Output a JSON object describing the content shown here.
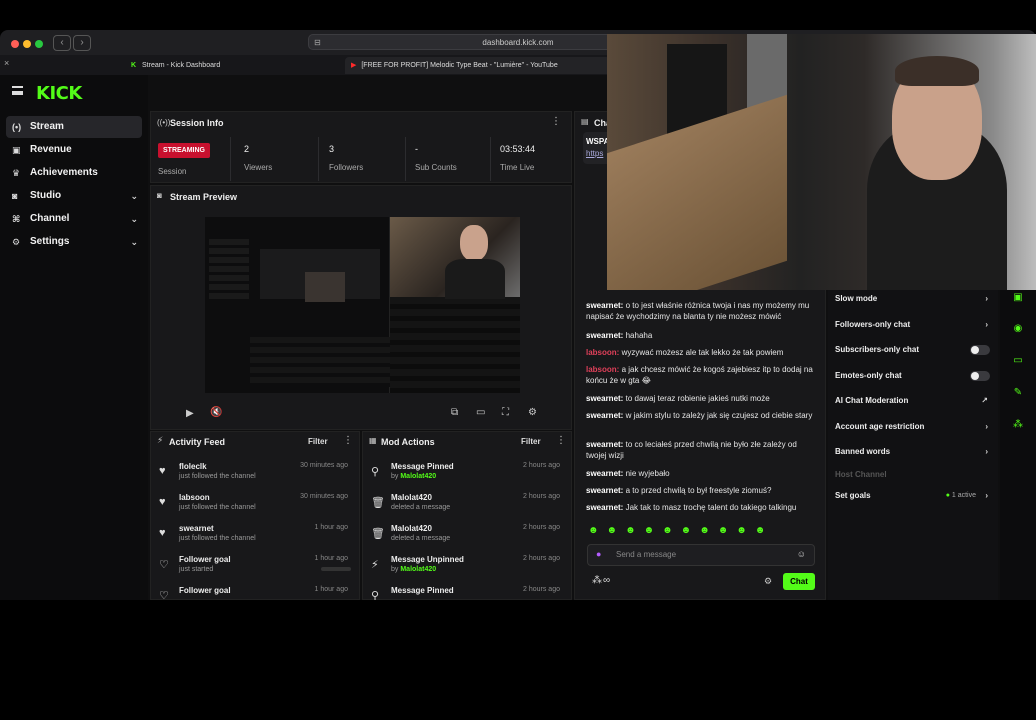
{
  "browser": {
    "url": "dashboard.kick.com",
    "tabs": [
      {
        "label": "Stream - Kick Dashboard"
      },
      {
        "label": "[FREE FOR PROFIT] Melodic Type Beat - \"Lumière\" - YouTube"
      }
    ]
  },
  "colors": {
    "brand": "#53fc18",
    "live": "#c8102e",
    "bg": "#0f0f10",
    "panel": "#18181a"
  },
  "sidebar": {
    "logo": "KICK",
    "items": [
      {
        "label": "Stream",
        "icon": "broadcast-icon",
        "active": true
      },
      {
        "label": "Revenue",
        "icon": "wallet-icon"
      },
      {
        "label": "Achievements",
        "icon": "trophy-icon"
      },
      {
        "label": "Studio",
        "icon": "video-icon",
        "expandable": true
      },
      {
        "label": "Channel",
        "icon": "channel-icon",
        "expandable": true
      },
      {
        "label": "Settings",
        "icon": "gear-icon",
        "expandable": true
      }
    ]
  },
  "session": {
    "title": "Session Info",
    "status": "STREAMING",
    "session_label": "Session",
    "stats": [
      {
        "value": "2",
        "label": "Viewers"
      },
      {
        "value": "3",
        "label": "Followers"
      },
      {
        "value": "-",
        "label": "Sub Counts"
      },
      {
        "value": "03:53:44",
        "label": "Time Live"
      }
    ]
  },
  "preview": {
    "title": "Stream Preview"
  },
  "activity": {
    "title": "Activity Feed",
    "filter": "Filter",
    "items": [
      {
        "name": "floleclk",
        "sub": "just followed the channel",
        "time": "30 minutes ago"
      },
      {
        "name": "labsoon",
        "sub": "just followed the channel",
        "time": "30 minutes ago"
      },
      {
        "name": "swearnet",
        "sub": "just followed the channel",
        "time": "1 hour ago"
      },
      {
        "name": "Follower goal",
        "sub": "just started",
        "time": "1 hour ago"
      },
      {
        "name": "Follower goal",
        "sub": "",
        "time": "1 hour ago"
      }
    ]
  },
  "mod": {
    "title": "Mod Actions",
    "filter": "Filter",
    "items": [
      {
        "name": "Message Pinned",
        "prefix": "by ",
        "who": "Malolat420",
        "sub": "",
        "time": "2 hours ago"
      },
      {
        "name": "Malolat420",
        "prefix": "",
        "who": "",
        "sub": "deleted a message",
        "time": "2 hours ago"
      },
      {
        "name": "Malolat420",
        "prefix": "",
        "who": "",
        "sub": "deleted a message",
        "time": "2 hours ago"
      },
      {
        "name": "Message Unpinned",
        "prefix": "by ",
        "who": "Malolat420",
        "sub": "",
        "time": "2 hours ago"
      },
      {
        "name": "Message Pinned",
        "prefix": "",
        "who": "",
        "sub": "",
        "time": "2 hours ago"
      }
    ]
  },
  "chat": {
    "title": "Cha",
    "pinned_line1": "WSPA",
    "pinned_line2": "https",
    "messages": [
      {
        "user": "swearnet:",
        "text": "o to jest właśnie różnica twoja i nas my możemy mu napisać że wychodzimy na blanta ty nie możesz mówić",
        "red": false
      },
      {
        "user": "swearnet:",
        "text": "hahaha",
        "red": false
      },
      {
        "user": "labsoon:",
        "text": "wyzywać możesz ale tak lekko że tak powiem",
        "red": true
      },
      {
        "user": "labsoon:",
        "text": "a jak chcesz mówić że kogoś zajebiesz itp to dodaj na końcu że w gta 😂",
        "red": true
      },
      {
        "user": "swearnet:",
        "text": "to dawaj teraz robienie jakieś nutki może",
        "red": false
      },
      {
        "user": "swearnet:",
        "text": "w jakim stylu to zależy jak się czujesz od ciebie stary",
        "red": false
      },
      {
        "user": "swearnet:",
        "text": "to co leciałeś przed chwilą nie było złe zależy od twojej wizji",
        "red": false
      },
      {
        "user": "swearnet:",
        "text": "nie wyjebało",
        "red": false
      },
      {
        "user": "swearnet:",
        "text": "a to przed chwilą to był freestyle ziomuś?",
        "red": false
      },
      {
        "user": "swearnet:",
        "text": "Jak tak to masz trochę talent do takiego talkingu",
        "red": false
      }
    ],
    "placeholder": "Send a message",
    "send": "Chat",
    "infinity": "∞"
  },
  "chat_settings": {
    "items": [
      {
        "label": "Slow mode",
        "kind": "arrow"
      },
      {
        "label": "Followers-only chat",
        "kind": "arrow"
      },
      {
        "label": "Subscribers-only chat",
        "kind": "toggle"
      },
      {
        "label": "Emotes-only chat",
        "kind": "toggle"
      },
      {
        "label": "AI Chat Moderation",
        "kind": "ext"
      },
      {
        "label": "Account age restriction",
        "kind": "arrow"
      },
      {
        "label": "Banned words",
        "kind": "arrow"
      },
      {
        "label": "Host Channel",
        "kind": "none"
      },
      {
        "label": "Set goals",
        "kind": "arrow"
      }
    ],
    "goals_active": "1 active"
  }
}
